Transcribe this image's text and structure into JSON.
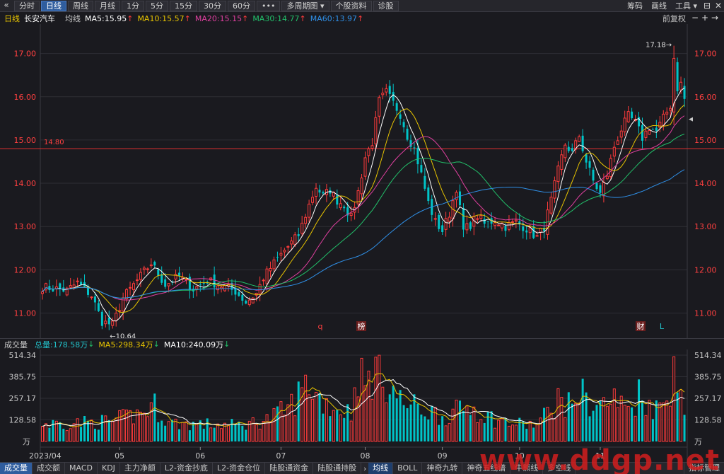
{
  "toolbar": {
    "back_icon": "«",
    "buttons": [
      {
        "label": "分时",
        "active": false
      },
      {
        "label": "日线",
        "active": true
      },
      {
        "label": "周线",
        "active": false
      },
      {
        "label": "月线",
        "active": false
      },
      {
        "label": "1分",
        "active": false
      },
      {
        "label": "5分",
        "active": false
      },
      {
        "label": "15分",
        "active": false
      },
      {
        "label": "30分",
        "active": false
      },
      {
        "label": "60分",
        "active": false
      },
      {
        "label": "•••",
        "active": false
      },
      {
        "label": "多周期图 ▾",
        "active": false
      },
      {
        "label": "个股资料",
        "active": false
      },
      {
        "label": "诊股",
        "active": false
      }
    ],
    "right": [
      "筹码",
      "画线",
      "工具 ▾"
    ],
    "window_icons": [
      "⊟",
      "✕"
    ]
  },
  "info": {
    "period": "日线",
    "name": "长安汽车",
    "ma_label": "均线",
    "ma5": "MA5:15.95",
    "ma10": "MA10:15.57",
    "ma20": "MA20:15.15",
    "ma30": "MA30:14.77",
    "ma60": "MA60:13.97",
    "adjust": "前复权",
    "zoom_icons": [
      "−",
      "+",
      "→"
    ]
  },
  "colors": {
    "up": "#ff3b3b",
    "down": "#00c4c8",
    "ma5": "#ffffff",
    "ma10": "#e6c300",
    "ma20": "#e040a0",
    "ma30": "#22c06a",
    "ma60": "#2f8fe6",
    "ref_line": "#e03030",
    "axis_text": "#ff4040",
    "grid": "#2e2e35"
  },
  "markers": {
    "high_label": "17.18",
    "low_label": "10.64",
    "ref_price": "14.80",
    "events": [
      "q",
      "榜",
      "财",
      "L"
    ]
  },
  "chart_data": [
    {
      "type": "candlestick",
      "title": "长安汽车 日线",
      "y_ticks": [
        "17.00",
        "16.00",
        "15.00",
        "14.00",
        "13.00",
        "12.00",
        "11.00"
      ],
      "ylim": [
        10.55,
        17.55
      ],
      "x_ticks": [
        "2023/04",
        "05",
        "06",
        "07",
        "08",
        "09",
        "10",
        "11"
      ],
      "reference_line": 14.8,
      "high": 17.18,
      "low": 10.64,
      "ma_last": {
        "MA5": 15.95,
        "MA10": 15.57,
        "MA20": 15.15,
        "MA30": 14.77,
        "MA60": 13.97
      },
      "kp": [
        [
          0,
          11.6
        ],
        [
          7,
          11.52
        ],
        [
          10,
          11.7
        ],
        [
          14,
          11.4
        ],
        [
          17,
          10.8
        ],
        [
          20,
          10.72
        ],
        [
          23,
          11.35
        ],
        [
          27,
          11.75
        ],
        [
          31,
          12.15
        ],
        [
          35,
          11.65
        ],
        [
          39,
          11.85
        ],
        [
          43,
          11.55
        ],
        [
          47,
          11.75
        ],
        [
          52,
          11.6
        ],
        [
          55,
          11.5
        ],
        [
          58,
          11.25
        ],
        [
          61,
          11.45
        ],
        [
          63,
          11.82
        ],
        [
          66,
          12.15
        ],
        [
          69,
          12.45
        ],
        [
          73,
          12.8
        ],
        [
          76,
          13.5
        ],
        [
          78,
          13.92
        ],
        [
          80,
          13.7
        ],
        [
          82,
          13.85
        ],
        [
          84,
          13.6
        ],
        [
          86,
          13.5
        ],
        [
          88,
          13.2
        ],
        [
          90,
          13.8
        ],
        [
          92,
          14.6
        ],
        [
          94,
          14.95
        ],
        [
          96,
          15.9
        ],
        [
          98,
          16.1
        ],
        [
          100,
          15.85
        ],
        [
          102,
          15.6
        ],
        [
          104,
          15.1
        ],
        [
          106,
          14.8
        ],
        [
          108,
          14.2
        ],
        [
          110,
          13.55
        ],
        [
          112,
          13.1
        ],
        [
          114,
          12.9
        ],
        [
          116,
          13.3
        ],
        [
          118,
          13.9
        ],
        [
          120,
          12.9
        ],
        [
          122,
          13.05
        ],
        [
          124,
          13.25
        ],
        [
          126,
          13.05
        ],
        [
          129,
          13.15
        ],
        [
          132,
          13.0
        ],
        [
          135,
          13.1
        ],
        [
          138,
          12.95
        ],
        [
          141,
          12.75
        ],
        [
          143,
          13.0
        ],
        [
          145,
          13.6
        ],
        [
          147,
          14.3
        ],
        [
          149,
          14.9
        ],
        [
          151,
          14.7
        ],
        [
          153,
          15.1
        ],
        [
          155,
          14.5
        ],
        [
          157,
          14.05
        ],
        [
          159,
          13.75
        ],
        [
          161,
          14.2
        ],
        [
          163,
          14.85
        ],
        [
          165,
          15.25
        ],
        [
          167,
          15.55
        ],
        [
          169,
          15.4
        ],
        [
          171,
          15.05
        ],
        [
          173,
          15.3
        ],
        [
          175,
          15.2
        ],
        [
          177,
          15.5
        ],
        [
          179,
          15.8
        ],
        [
          180,
          16.9
        ],
        [
          181,
          16.2
        ],
        [
          182,
          16.3
        ],
        [
          183,
          15.95
        ]
      ]
    },
    {
      "type": "bar",
      "title": "成交量",
      "total_label": "总量:178.58万",
      "ma5_label": "MA5:298.34万",
      "ma10_label": "MA10:240.09万",
      "y_ticks": [
        "514.34",
        "385.75",
        "257.17",
        "128.58"
      ],
      "ylim": [
        0,
        514.34
      ],
      "unit": "万",
      "x_ticks": [
        "2023/04",
        "05",
        "06",
        "07",
        "08",
        "09",
        "10",
        "11"
      ],
      "vp": [
        [
          0,
          110
        ],
        [
          10,
          120
        ],
        [
          20,
          130
        ],
        [
          28,
          180
        ],
        [
          32,
          230
        ],
        [
          36,
          120
        ],
        [
          45,
          110
        ],
        [
          55,
          105
        ],
        [
          60,
          120
        ],
        [
          65,
          150
        ],
        [
          70,
          210
        ],
        [
          74,
          330
        ],
        [
          76,
          380
        ],
        [
          78,
          300
        ],
        [
          80,
          260
        ],
        [
          84,
          210
        ],
        [
          88,
          190
        ],
        [
          90,
          460
        ],
        [
          92,
          350
        ],
        [
          94,
          440
        ],
        [
          96,
          500
        ],
        [
          99,
          360
        ],
        [
          102,
          260
        ],
        [
          105,
          230
        ],
        [
          108,
          210
        ],
        [
          110,
          200
        ],
        [
          114,
          160
        ],
        [
          118,
          190
        ],
        [
          122,
          230
        ],
        [
          126,
          170
        ],
        [
          130,
          135
        ],
        [
          134,
          115
        ],
        [
          138,
          110
        ],
        [
          141,
          105
        ],
        [
          144,
          190
        ],
        [
          147,
          270
        ],
        [
          150,
          230
        ],
        [
          153,
          320
        ],
        [
          157,
          230
        ],
        [
          160,
          240
        ],
        [
          163,
          270
        ],
        [
          165,
          230
        ],
        [
          168,
          220
        ],
        [
          170,
          310
        ],
        [
          173,
          250
        ],
        [
          175,
          210
        ],
        [
          178,
          260
        ],
        [
          180,
          490
        ],
        [
          181,
          330
        ],
        [
          182,
          260
        ],
        [
          183,
          180
        ]
      ]
    }
  ],
  "volume": {
    "name": "成交量",
    "total": "总量:178.58万",
    "ma5": "MA5:298.34万",
    "ma10": "MA10:240.09万"
  },
  "tabs": [
    {
      "label": "成交量",
      "state": "active"
    },
    {
      "label": "成交额",
      "state": ""
    },
    {
      "label": "MACD",
      "state": ""
    },
    {
      "label": "KDJ",
      "state": ""
    },
    {
      "label": "主力净额",
      "state": ""
    },
    {
      "label": "L2-资金抄底",
      "state": ""
    },
    {
      "label": "L2-资金仓位",
      "state": ""
    },
    {
      "label": "陆股通资金",
      "state": ""
    },
    {
      "label": "陆股通持股",
      "state": ""
    },
    {
      "label": "›",
      "state": "sep"
    },
    {
      "label": "均线",
      "state": "active2"
    },
    {
      "label": "BOLL",
      "state": ""
    },
    {
      "label": "神奇九转",
      "state": ""
    },
    {
      "label": "神奇五线谱",
      "state": ""
    },
    {
      "label": "牛熊线",
      "state": ""
    },
    {
      "label": "多空线",
      "state": ""
    }
  ],
  "tab_right": "指标管理",
  "watermark": "www.ddgp.net"
}
